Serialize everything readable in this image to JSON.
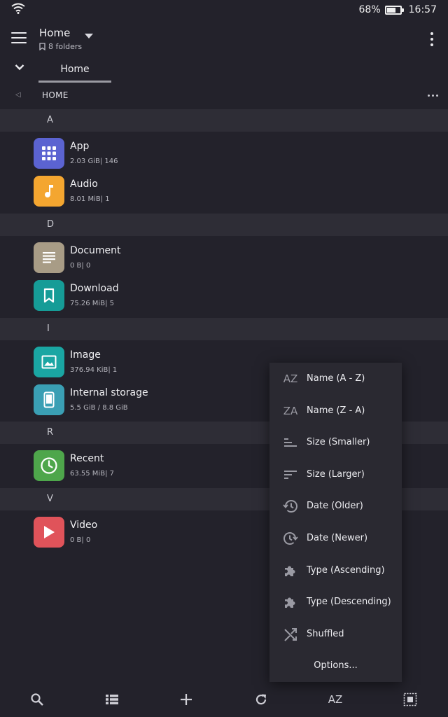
{
  "status": {
    "battery": "68%",
    "battery_level": 0.68,
    "time": "16:57"
  },
  "header": {
    "title": "Home",
    "subtitle": "8 folders"
  },
  "tabs": [
    {
      "label": "Home"
    }
  ],
  "breadcrumb": {
    "label": "HOME"
  },
  "sections": [
    {
      "letter": "A",
      "items": [
        {
          "name": "App",
          "meta": "2.03 GiB| 146",
          "icon": "grid-icon",
          "color": "#5b63d1"
        },
        {
          "name": "Audio",
          "meta": "8.01 MiB| 1",
          "icon": "music-note-icon",
          "color": "#f4a630"
        }
      ]
    },
    {
      "letter": "D",
      "items": [
        {
          "name": "Document",
          "meta": "0 B| 0",
          "icon": "document-icon",
          "color": "#a89c86"
        },
        {
          "name": "Download",
          "meta": "75.26 MiB| 5",
          "icon": "bookmark-icon",
          "color": "#169c97"
        }
      ]
    },
    {
      "letter": "I",
      "items": [
        {
          "name": "Image",
          "meta": "376.94 KiB| 1",
          "icon": "image-icon",
          "color": "#1aa6a3"
        },
        {
          "name": "Internal storage",
          "meta": "5.5 GiB / 8.8 GiB",
          "icon": "phone-icon",
          "color": "#3a9fb4"
        }
      ]
    },
    {
      "letter": "R",
      "items": [
        {
          "name": "Recent",
          "meta": "63.55 MiB| 7",
          "icon": "clock-icon",
          "color": "#4ea64b"
        }
      ]
    },
    {
      "letter": "V",
      "items": [
        {
          "name": "Video",
          "meta": "0 B| 0",
          "icon": "play-icon",
          "color": "#e0535a"
        }
      ]
    }
  ],
  "sort_menu": {
    "items": [
      {
        "label": "Name (A - Z)",
        "glyph": "AZ",
        "icon": "sort-az-icon"
      },
      {
        "label": "Name (Z - A)",
        "glyph": "ZA",
        "icon": "sort-za-icon"
      },
      {
        "label": "Size (Smaller)",
        "icon": "sort-size-asc-icon"
      },
      {
        "label": "Size (Larger)",
        "icon": "sort-size-desc-icon"
      },
      {
        "label": "Date (Older)",
        "icon": "history-icon"
      },
      {
        "label": "Date (Newer)",
        "icon": "clock-forward-icon"
      },
      {
        "label": "Type (Ascending)",
        "icon": "puzzle-icon"
      },
      {
        "label": "Type (Descending)",
        "icon": "puzzle-icon"
      },
      {
        "label": "Shuffled",
        "icon": "shuffle-icon"
      },
      {
        "label": "Options..."
      }
    ]
  },
  "bottom_bar": {
    "sort_glyph": "AZ"
  }
}
